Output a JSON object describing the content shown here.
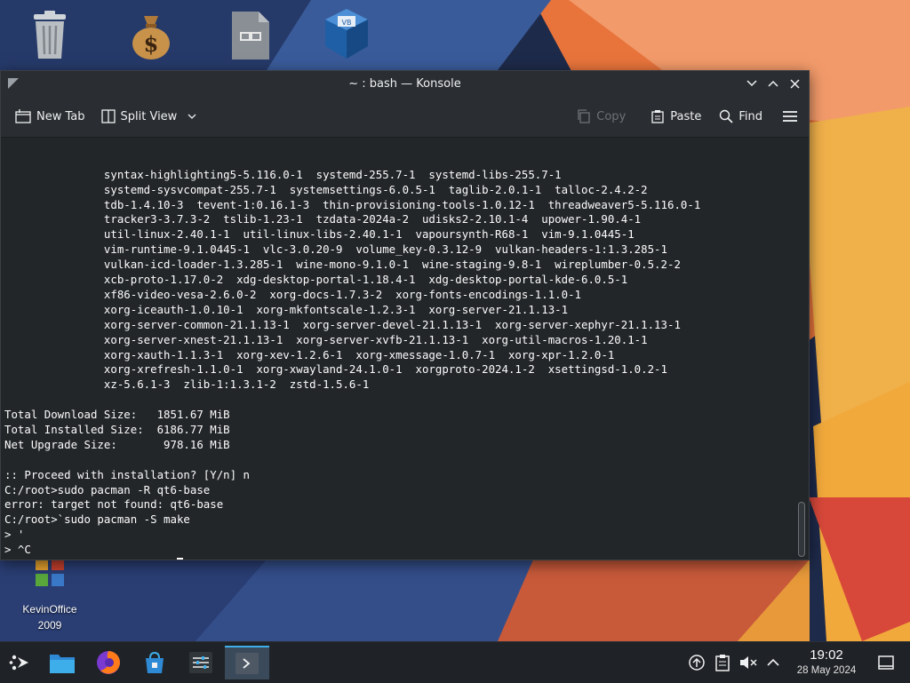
{
  "desktop": {
    "icons": [
      {
        "name": "trash-icon"
      },
      {
        "name": "money-bag-icon"
      },
      {
        "name": "file-archive-icon"
      },
      {
        "name": "virtualbox-icon"
      }
    ],
    "kevinoffice_label_line1": "KevinOffice",
    "kevinoffice_label_line2": "2009"
  },
  "window": {
    "title": "~ : bash — Konsole"
  },
  "toolbar": {
    "new_tab": "New Tab",
    "split_view": "Split View",
    "copy": "Copy",
    "paste": "Paste",
    "find": "Find"
  },
  "terminal": {
    "lines": [
      "               syntax-highlighting5-5.116.0-1  systemd-255.7-1  systemd-libs-255.7-1",
      "               systemd-sysvcompat-255.7-1  systemsettings-6.0.5-1  taglib-2.0.1-1  talloc-2.4.2-2",
      "               tdb-1.4.10-3  tevent-1:0.16.1-3  thin-provisioning-tools-1.0.12-1  threadweaver5-5.116.0-1",
      "               tracker3-3.7.3-2  tslib-1.23-1  tzdata-2024a-2  udisks2-2.10.1-4  upower-1.90.4-1",
      "               util-linux-2.40.1-1  util-linux-libs-2.40.1-1  vapoursynth-R68-1  vim-9.1.0445-1",
      "               vim-runtime-9.1.0445-1  vlc-3.0.20-9  volume_key-0.3.12-9  vulkan-headers-1:1.3.285-1",
      "               vulkan-icd-loader-1.3.285-1  wine-mono-9.1.0-1  wine-staging-9.8-1  wireplumber-0.5.2-2",
      "               xcb-proto-1.17.0-2  xdg-desktop-portal-1.18.4-1  xdg-desktop-portal-kde-6.0.5-1",
      "               xf86-video-vesa-2.6.0-2  xorg-docs-1.7.3-2  xorg-fonts-encodings-1.1.0-1",
      "               xorg-iceauth-1.0.10-1  xorg-mkfontscale-1.2.3-1  xorg-server-21.1.13-1",
      "               xorg-server-common-21.1.13-1  xorg-server-devel-21.1.13-1  xorg-server-xephyr-21.1.13-1",
      "               xorg-server-xnest-21.1.13-1  xorg-server-xvfb-21.1.13-1  xorg-util-macros-1.20.1-1",
      "               xorg-xauth-1.1.3-1  xorg-xev-1.2.6-1  xorg-xmessage-1.0.7-1  xorg-xpr-1.2.0-1",
      "               xorg-xrefresh-1.1.0-1  xorg-xwayland-24.1.0-1  xorgproto-2024.1-2  xsettingsd-1.0.2-1",
      "               xz-5.6.1-3  zlib-1:1.3.1-2  zstd-1.5.6-1",
      "",
      "Total Download Size:   1851.67 MiB",
      "Total Installed Size:  6186.77 MiB",
      "Net Upgrade Size:       978.16 MiB",
      "",
      ":: Proceed with installation? [Y/n] n",
      "C:/root>sudo pacman -R qt6-base",
      "error: target not found: qt6-base",
      "C:/root>`sudo pacman -S make",
      "> '",
      "> ^C"
    ],
    "prompt_line_before_cursor": "C:/root>sudo pacman -S mak",
    "prompt_cursor_char": "e"
  },
  "taskbar": {
    "items": [
      {
        "name": "application-launcher-icon"
      },
      {
        "name": "file-manager-icon"
      },
      {
        "name": "firefox-icon"
      },
      {
        "name": "discover-store-icon"
      },
      {
        "name": "system-settings-icon"
      },
      {
        "name": "konsole-icon"
      }
    ],
    "tray": [
      {
        "name": "updates-icon"
      },
      {
        "name": "clipboard-icon"
      },
      {
        "name": "volume-muted-icon"
      },
      {
        "name": "chevron-up-icon"
      }
    ],
    "clock_time": "19:02",
    "clock_date": "28 May 2024"
  },
  "colors": {
    "accent": "#3daee9",
    "terminal_bg": "#232629",
    "terminal_fg": "#fcfcfc"
  }
}
